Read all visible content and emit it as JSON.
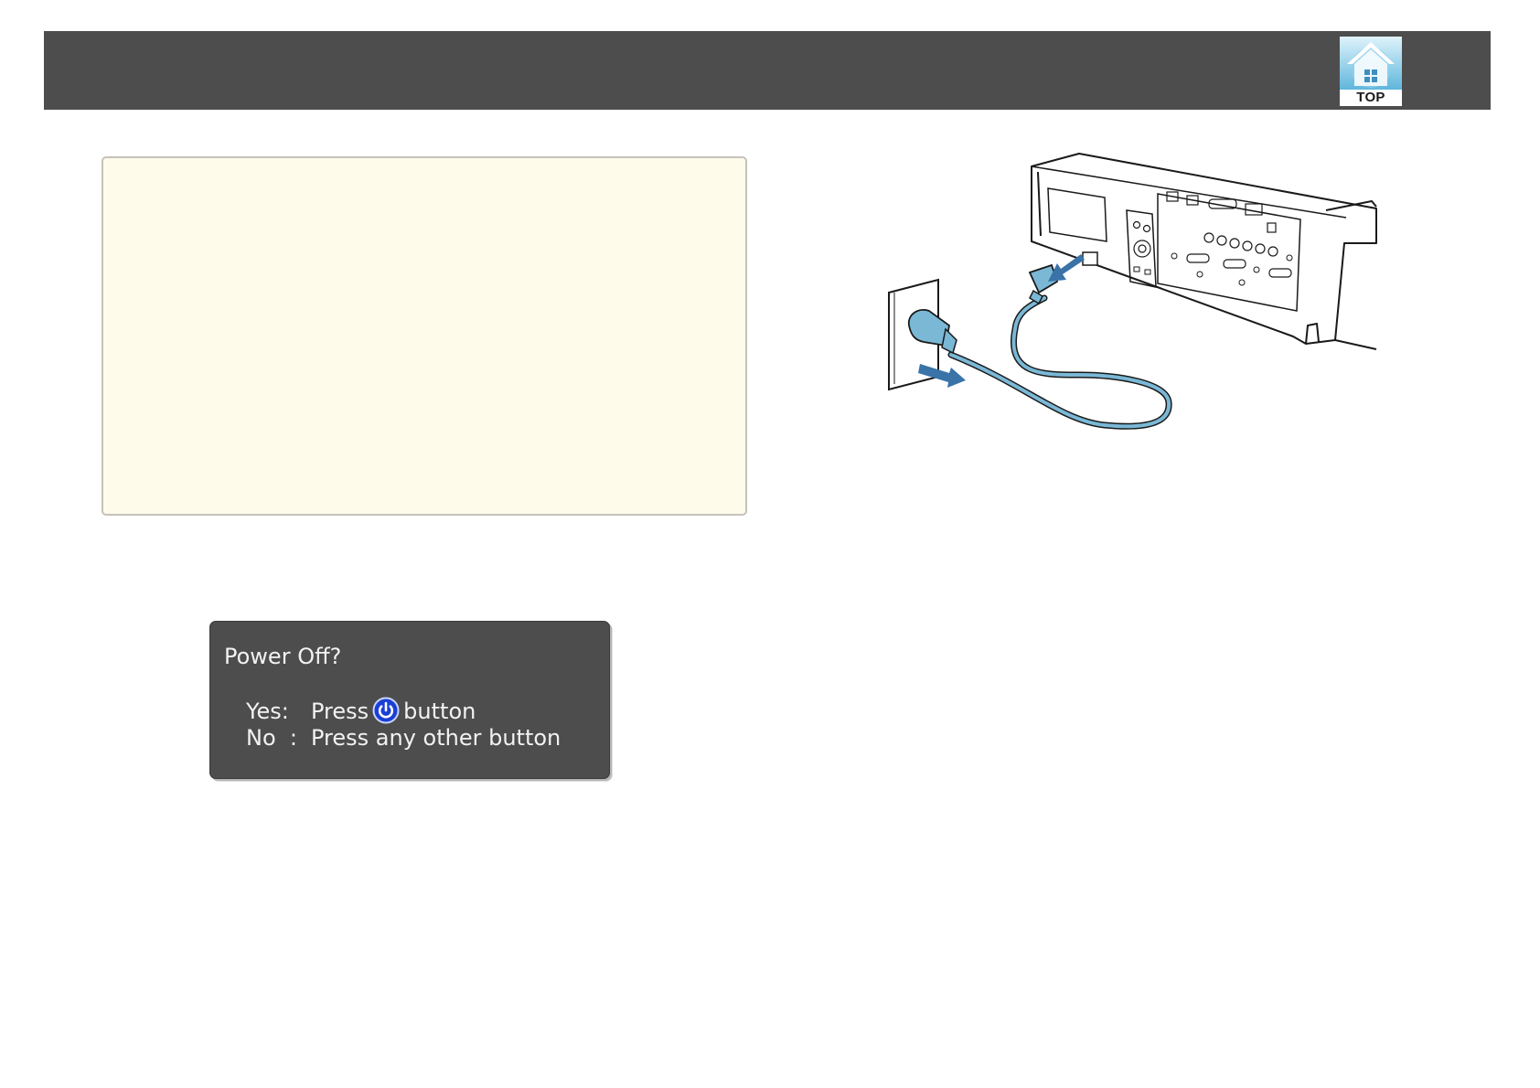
{
  "header": {
    "top_button": {
      "label": "TOP",
      "icon": "home-icon"
    }
  },
  "note_box": {
    "background_color": "#fffbeb"
  },
  "dialog": {
    "title": "Power Off?",
    "yes": {
      "label": "Yes:",
      "prefix": "Press",
      "icon": "power-icon",
      "suffix": "button"
    },
    "no": {
      "label": "No  :",
      "text": "Press any other button"
    }
  },
  "illustration": {
    "subject": "power-cord-disconnect",
    "accent_color": "#7ab8d6",
    "arrow_color": "#3a73a8"
  },
  "colors": {
    "header_bar": "#4d4d4d",
    "dialog_background": "#4d4d4d",
    "power_button_blue": "#1a3fd6"
  }
}
